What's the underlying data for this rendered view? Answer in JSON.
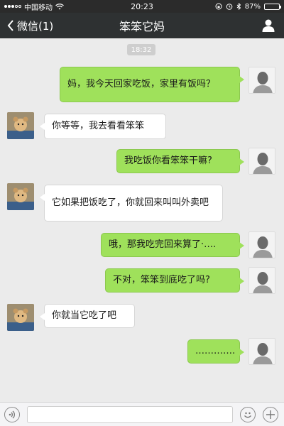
{
  "status_bar": {
    "carrier": "中国移动",
    "time": "20:23",
    "battery_percent": "87%",
    "battery_level": 0.87
  },
  "nav": {
    "back_label": "微信(1)",
    "title": "笨笨它妈",
    "back_icon": "chevron-left-icon",
    "profile_icon": "person-icon"
  },
  "chat": {
    "timestamp": "18:32",
    "messages": [
      {
        "from": "me",
        "text": "妈，我今天回家吃饭，家里有饭吗？"
      },
      {
        "from": "mom",
        "text": "你等等，我去看看笨笨"
      },
      {
        "from": "me",
        "text": "我吃饭你看笨笨干嘛?"
      },
      {
        "from": "mom",
        "text": "它如果把饭吃了，你就回来叫叫外卖吧"
      },
      {
        "from": "me",
        "text": "哦，那我吃完回来算了·…."
      },
      {
        "from": "me",
        "text": "不对，笨笨到底吃了吗?"
      },
      {
        "from": "mom",
        "text": "你就当它吃了吧"
      },
      {
        "from": "me",
        "text": "…………."
      }
    ]
  },
  "input_bar": {
    "voice_icon": "voice-icon",
    "emoji_icon": "emoji-icon",
    "plus_icon": "plus-icon"
  },
  "colors": {
    "outgoing_bubble": "#9fe15b",
    "incoming_bubble": "#ffffff",
    "nav_background": "#2e3132",
    "chat_background": "#ebebeb"
  }
}
